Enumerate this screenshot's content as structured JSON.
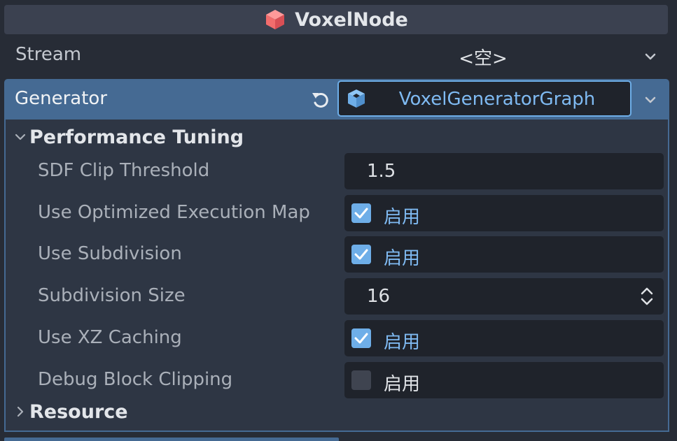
{
  "header": {
    "title": "VoxelNode",
    "icon": "voxel-node-icon",
    "icon_color": "#f26d6d"
  },
  "stream": {
    "label": "Stream",
    "value": "<空>"
  },
  "generator": {
    "label": "Generator",
    "resource_name": "VoxelGeneratorGraph",
    "accent": "#6eaee8",
    "row_color": "#456a93"
  },
  "sections": {
    "performance": "Performance Tuning",
    "resource": "Resource"
  },
  "properties": [
    {
      "label": "SDF Clip Threshold",
      "type": "number",
      "value": "1.5"
    },
    {
      "label": "Use Optimized Execution Map",
      "type": "checkbox",
      "checked": true,
      "text": "启用"
    },
    {
      "label": "Use Subdivision",
      "type": "checkbox",
      "checked": true,
      "text": "启用"
    },
    {
      "label": "Subdivision Size",
      "type": "spin",
      "value": "16"
    },
    {
      "label": "Use XZ Caching",
      "type": "checkbox",
      "checked": true,
      "text": "启用"
    },
    {
      "label": "Debug Block Clipping",
      "type": "checkbox",
      "checked": false,
      "text": "启用"
    }
  ]
}
